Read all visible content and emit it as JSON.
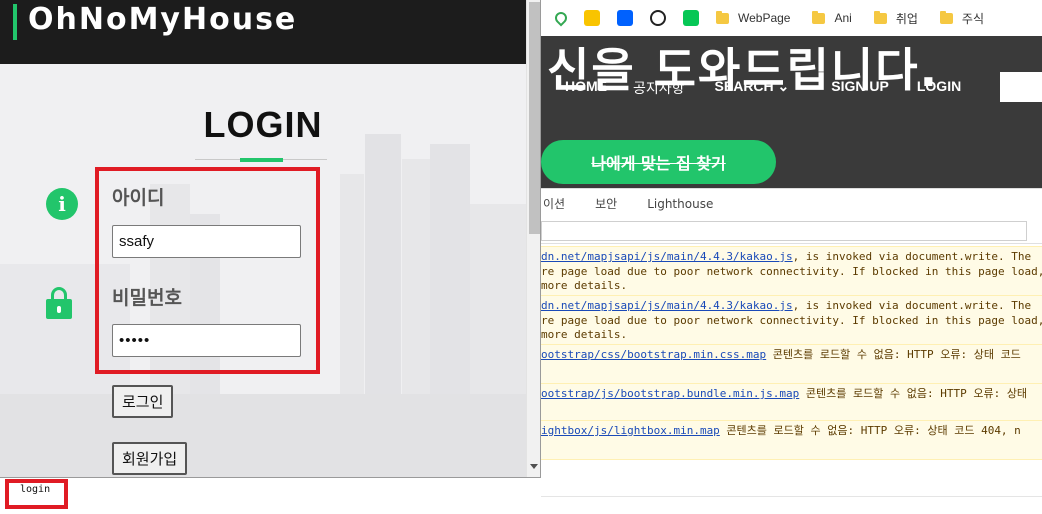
{
  "popup": {
    "brand": "OhNoMyHouse",
    "login_title": "LOGIN",
    "id_label": "아이디",
    "id_value": "ssafy",
    "password_label": "비밀번호",
    "password_value": "•••••",
    "login_button": "로그인",
    "signup_button": "회원가입",
    "info_icon_glyph": "i",
    "accent_color": "#22c56b",
    "highlight_color": "#e01b24"
  },
  "status_bar": {
    "text": "login"
  },
  "browser": {
    "bookmarks": [
      {
        "icon": "maps-icon"
      },
      {
        "icon": "map-pin-icon"
      },
      {
        "icon": "dropbox-icon"
      },
      {
        "icon": "panda-icon"
      },
      {
        "icon": "line-chat-icon"
      }
    ],
    "bookmark_folders": [
      "WebPage",
      "Ani",
      "취업",
      "주식"
    ],
    "hero_title": "신을 도와드립니다.",
    "hero_nav": [
      "HOME",
      "공지사항",
      "SEARCH ⌄",
      "SIGN UP",
      "LOGIN"
    ],
    "hero_button": "나에게 맞는 집 찾기"
  },
  "devtools": {
    "tabs": [
      "이션",
      "보안",
      "Lighthouse"
    ],
    "console_messages": [
      {
        "link": "dn.net/mapjsapi/js/main/4.4.3/kakao.js",
        "text": ", is invoked via document.write. The",
        "line2": "re page load due to poor network connectivity. If blocked in this page load,",
        "line3": "more details."
      },
      {
        "link": "dn.net/mapjsapi/js/main/4.4.3/kakao.js",
        "text": ", is invoked via document.write. The",
        "line2": "re page load due to poor network connectivity. If blocked in this page load,",
        "line3": "more details."
      },
      {
        "link": "ootstrap/css/bootstrap.min.css.map",
        "text": " 콘텐츠를 로드할 수 없음: HTTP 오류: 상태 코드"
      },
      {
        "link": "ootstrap/js/bootstrap.bundle.min.js.map",
        "text": " 콘텐츠를 로드할 수 없음: HTTP 오류: 상태"
      },
      {
        "link": "ightbox/js/lightbox.min.map",
        "text": " 콘텐츠를 로드할 수 없음: HTTP 오류: 상태 코드 404, n"
      }
    ]
  }
}
